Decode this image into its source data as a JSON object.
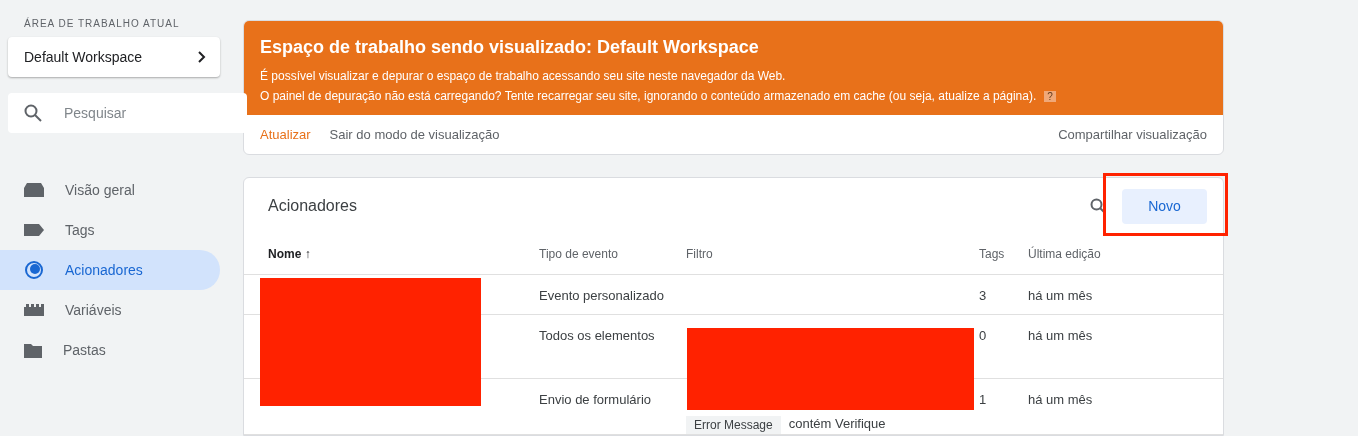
{
  "sidebar": {
    "workspace_label": "ÁREA DE TRABALHO ATUAL",
    "workspace": "Default Workspace",
    "search": {
      "placeholder": "Pesquisar"
    },
    "items": [
      {
        "label": "Visão geral",
        "selected": false
      },
      {
        "label": "Tags",
        "selected": false
      },
      {
        "label": "Acionadores",
        "selected": true
      },
      {
        "label": "Variáveis",
        "selected": false
      },
      {
        "label": "Pastas",
        "selected": false
      }
    ]
  },
  "banner": {
    "title": "Espaço de trabalho sendo visualizado: Default Workspace",
    "lines": [
      "É possível visualizar e depurar o espaço de trabalho acessando seu site neste navegador da Web.",
      "O painel de depuração não está carregando? Tente recarregar seu site, ignorando o conteúdo armazenado em cache (ou seja, atualize a página)."
    ],
    "help": "?",
    "actions": [
      "Atualizar",
      "Sair do modo de visualização"
    ],
    "share": "Compartilhar visualização"
  },
  "triggers": {
    "title": "Acionadores",
    "new_button": "Novo",
    "columns": [
      "Nome",
      "Tipo de evento",
      "Filtro",
      "Tags",
      "Última edição"
    ],
    "sort_arrow": "↑",
    "rows": [
      {
        "event": "Evento personalizado",
        "filter": [],
        "tags": "3",
        "edited": "há um mês"
      },
      {
        "event": "Todos os elementos",
        "filter": [],
        "tags": "0",
        "edited": "há um mês"
      },
      {
        "event": "Envio de formulário",
        "filter": [
          {
            "chip": "Error Message",
            "text": "contém Verifique"
          }
        ],
        "tags": "1",
        "edited": "há um mês"
      }
    ]
  }
}
